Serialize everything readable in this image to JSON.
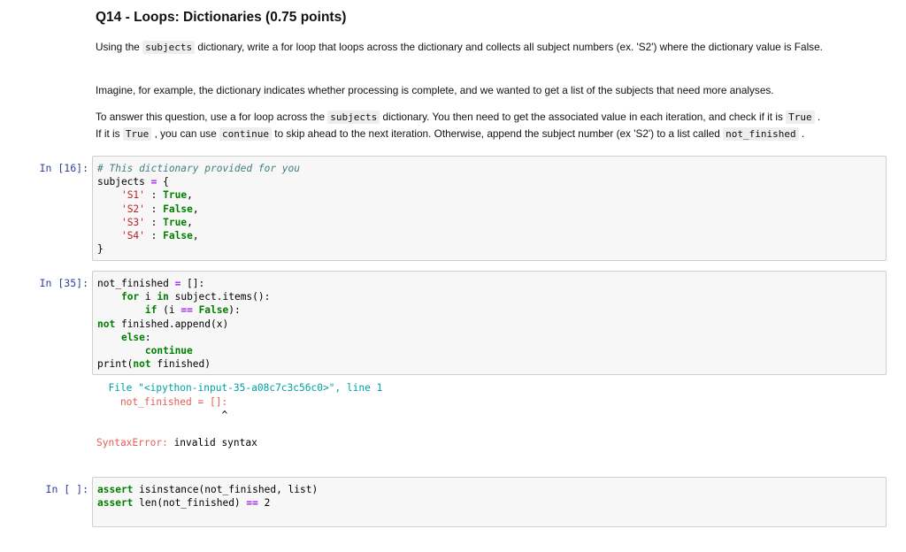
{
  "question": {
    "title": "Q14 - Loops: Dictionaries (0.75 points)",
    "p1_a": "Using the ",
    "p1_code": "subjects",
    "p1_b": " dictionary, write a for loop that loops across the dictionary and collects all subject numbers (ex. 'S2') where the dictionary value is False.",
    "p2": "Imagine, for example, the dictionary indicates whether processing is complete, and we wanted to get a list of the subjects that need more analyses.",
    "p3_a": "To answer this question, use a for loop across the ",
    "p3_code1": "subjects",
    "p3_b": " dictionary. You then need to get the associated value in each iteration, and check if it is ",
    "p3_code2": "True",
    "p3_c": " .",
    "p3_d": "If it is ",
    "p3_code3": "True",
    "p3_e": " , you can use ",
    "p3_code4": "continue",
    "p3_f": " to skip ahead to the next iteration. Otherwise, append the subject number (ex 'S2') to a list called ",
    "p3_code5": "not_finished",
    "p3_g": " ."
  },
  "cells": [
    {
      "prompt": "In [16]:",
      "comment": "# This dictionary provided for you",
      "l2": "subjects ",
      "l2op": "=",
      "l2b": " {",
      "rows": [
        {
          "key": "'S1'",
          "sep": " : ",
          "val": "True",
          "end": ","
        },
        {
          "key": "'S2'",
          "sep": " : ",
          "val": "False",
          "end": ","
        },
        {
          "key": "'S3'",
          "sep": " : ",
          "val": "True",
          "end": ","
        },
        {
          "key": "'S4'",
          "sep": " : ",
          "val": "False",
          "end": ","
        }
      ],
      "close": "}"
    },
    {
      "prompt": "In [35]:",
      "l1a": "not_finished ",
      "l1op": "=",
      "l1b": " []:",
      "l2kw1": "for",
      "l2a": " i ",
      "l2kw2": "in",
      "l2b": " subject.items():",
      "l3kw": "if",
      "l3a": " (i ",
      "l3op": "==",
      "l3kw2": "False",
      "l3b": "):",
      "l4kw": "not",
      "l4a": " finished.append(x)",
      "l5kw": "else",
      "l5a": ":",
      "l6kw": "continue",
      "l7a": "print(",
      "l7kw": "not",
      "l7b": " finished)",
      "error": {
        "file_line": "  File \"<ipython-input-35-a08c7c3c56c0>\", line 1",
        "code_line": "    not_finished = []:",
        "caret": "                     ^",
        "type": "SyntaxError:",
        "msg": " invalid syntax"
      }
    },
    {
      "prompt": "In [ ]:",
      "l1kw": "assert",
      "l1a": " isinstance(not_finished, list)",
      "l2kw": "assert",
      "l2a": " len(not_finished) ",
      "l2op": "==",
      "l2b": " 2"
    }
  ]
}
